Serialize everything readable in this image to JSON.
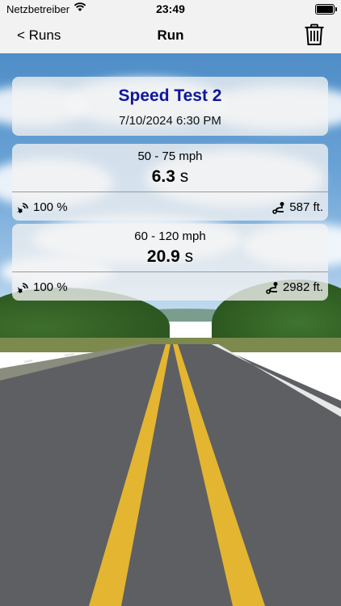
{
  "status_bar": {
    "carrier": "Netzbetreiber",
    "time": "23:49"
  },
  "nav": {
    "back_label": "< Runs",
    "title": "Run"
  },
  "run": {
    "title": "Speed Test 2",
    "date": "7/10/2024 6:30 PM"
  },
  "results": [
    {
      "range": "50 - 75  mph",
      "duration": "6.3",
      "unit": "s",
      "accuracy": "100  %",
      "distance": "587  ft."
    },
    {
      "range": "60 - 120  mph",
      "duration": "20.9",
      "unit": "s",
      "accuracy": "100  %",
      "distance": "2982  ft."
    }
  ],
  "colors": {
    "accent": "#0f1799",
    "bar_bg": "#f2f2f2",
    "card_bg": "#f2f2f2"
  },
  "icons": {
    "wifi": "wifi-icon",
    "battery": "battery-icon",
    "trash": "trash-icon",
    "accuracy": "gps-signal-icon",
    "distance": "route-icon"
  }
}
